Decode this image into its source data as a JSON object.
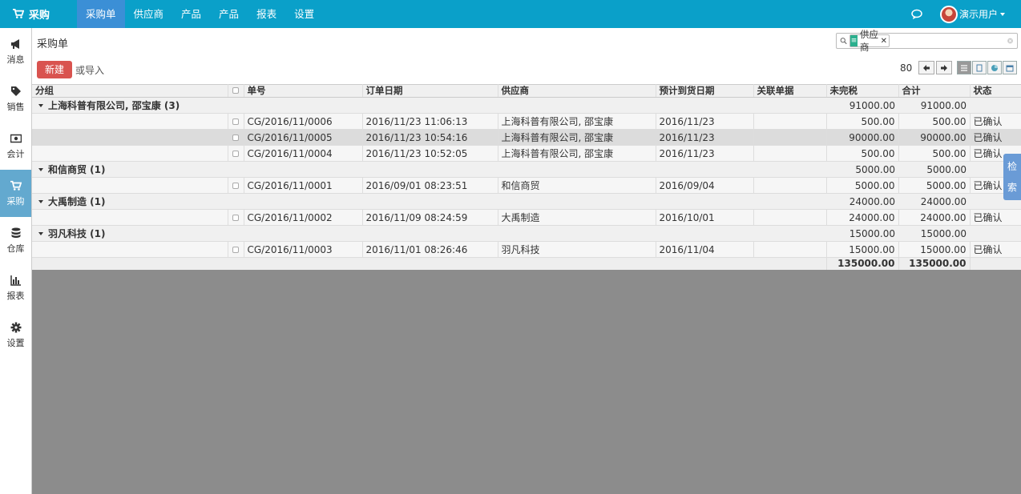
{
  "app": {
    "brand": "采购"
  },
  "topnav": [
    {
      "label": "采购单",
      "active": true
    },
    {
      "label": "供应商",
      "active": false
    },
    {
      "label": "产品",
      "active": false
    },
    {
      "label": "产品",
      "active": false
    },
    {
      "label": "报表",
      "active": false
    },
    {
      "label": "设置",
      "active": false
    }
  ],
  "user": {
    "name": "演示用户"
  },
  "sidebar": [
    {
      "label": "消息",
      "icon": "megaphone-icon"
    },
    {
      "label": "销售",
      "icon": "tag-icon"
    },
    {
      "label": "会计",
      "icon": "money-icon"
    },
    {
      "label": "采购",
      "icon": "cart-icon",
      "active": true
    },
    {
      "label": "仓库",
      "icon": "database-icon"
    },
    {
      "label": "报表",
      "icon": "bar-chart-icon"
    },
    {
      "label": "设置",
      "icon": "gear-icon"
    }
  ],
  "page": {
    "title": "采购单",
    "new_button": "新建",
    "import_link": "或导入",
    "record_count": "80"
  },
  "search": {
    "facet_label": "供应商",
    "facet_icon": "group-by-icon",
    "value": ""
  },
  "table": {
    "headers": {
      "group": "分组",
      "number": "单号",
      "order_date": "订单日期",
      "supplier": "供应商",
      "expected_date": "预计到货日期",
      "related": "关联单据",
      "untaxed": "未完税",
      "total": "合计",
      "status": "状态"
    },
    "groups": [
      {
        "name": "上海科普有限公司, 邵宝康 (3)",
        "untaxed": "91000.00",
        "total": "91000.00",
        "rows": [
          {
            "number": "CG/2016/11/0006",
            "order_date": "2016/11/23 11:06:13",
            "supplier": "上海科普有限公司, 邵宝康",
            "expected_date": "2016/11/23",
            "related": "",
            "untaxed": "500.00",
            "total": "500.00",
            "status": "已确认"
          },
          {
            "number": "CG/2016/11/0005",
            "order_date": "2016/11/23 10:54:16",
            "supplier": "上海科普有限公司, 邵宝康",
            "expected_date": "2016/11/23",
            "related": "",
            "untaxed": "90000.00",
            "total": "90000.00",
            "status": "已确认"
          },
          {
            "number": "CG/2016/11/0004",
            "order_date": "2016/11/23 10:52:05",
            "supplier": "上海科普有限公司, 邵宝康",
            "expected_date": "2016/11/23",
            "related": "",
            "untaxed": "500.00",
            "total": "500.00",
            "status": "已确认"
          }
        ]
      },
      {
        "name": "和信商贸 (1)",
        "untaxed": "5000.00",
        "total": "5000.00",
        "rows": [
          {
            "number": "CG/2016/11/0001",
            "order_date": "2016/09/01 08:23:51",
            "supplier": "和信商贸",
            "expected_date": "2016/09/04",
            "related": "",
            "untaxed": "5000.00",
            "total": "5000.00",
            "status": "已确认"
          }
        ]
      },
      {
        "name": "大禹制造 (1)",
        "untaxed": "24000.00",
        "total": "24000.00",
        "rows": [
          {
            "number": "CG/2016/11/0002",
            "order_date": "2016/11/09 08:24:59",
            "supplier": "大禹制造",
            "expected_date": "2016/10/01",
            "related": "",
            "untaxed": "24000.00",
            "total": "24000.00",
            "status": "已确认"
          }
        ]
      },
      {
        "name": "羽凡科技 (1)",
        "untaxed": "15000.00",
        "total": "15000.00",
        "rows": [
          {
            "number": "CG/2016/11/0003",
            "order_date": "2016/11/01 08:26:46",
            "supplier": "羽凡科技",
            "expected_date": "2016/11/04",
            "related": "",
            "untaxed": "15000.00",
            "total": "15000.00",
            "status": "已确认"
          }
        ]
      }
    ],
    "totals": {
      "untaxed": "135000.00",
      "total": "135000.00"
    }
  },
  "side_tab": {
    "line1": "检",
    "line2": "索"
  }
}
